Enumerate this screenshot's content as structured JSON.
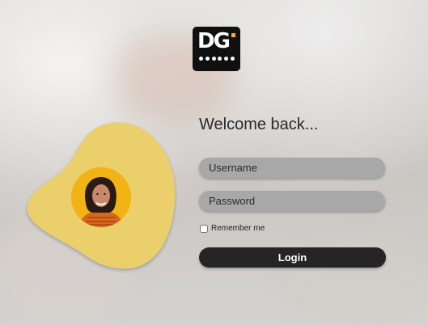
{
  "brand": {
    "logo_text": "DG",
    "accent_color": "#f2b315",
    "logo_icon": "dg-logo-icon"
  },
  "login": {
    "heading": "Welcome back...",
    "username_placeholder": "Username",
    "password_placeholder": "Password",
    "remember_label": "Remember me",
    "submit_label": "Login"
  },
  "colors": {
    "blob": "#eacf6a",
    "avatar_bg": "#f2b315",
    "button": "#252525",
    "field": "#a8a8a8"
  }
}
